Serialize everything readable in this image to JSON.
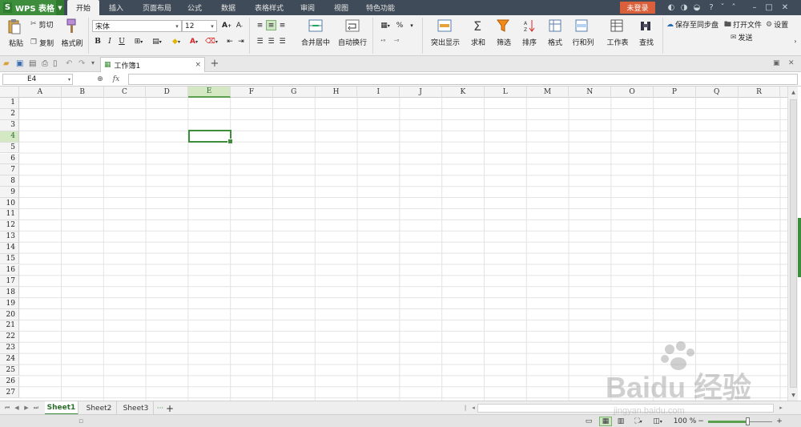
{
  "app": {
    "name": "WPS 表格",
    "logo_letter": "S"
  },
  "menu_tabs": [
    {
      "label": "开始",
      "active": true
    },
    {
      "label": "插入"
    },
    {
      "label": "页面布局"
    },
    {
      "label": "公式"
    },
    {
      "label": "数据"
    },
    {
      "label": "表格样式"
    },
    {
      "label": "审阅"
    },
    {
      "label": "视图"
    },
    {
      "label": "特色功能"
    }
  ],
  "login_label": "未登录",
  "title_controls": [
    "?",
    "ˇ",
    "˄",
    "–",
    "□",
    "✕"
  ],
  "ribbon": {
    "paste": "粘贴",
    "cut": "剪切",
    "copy": "复制",
    "format_painter": "格式刷",
    "font_name": "宋体",
    "font_size": "12",
    "bold": "B",
    "italic": "I",
    "underline": "U",
    "merge_center": "合并居中",
    "wrap_text": "自动换行",
    "percent": "%",
    "conditional_format": "突出显示",
    "sum": "求和",
    "filter": "筛选",
    "sort": "排序",
    "format": "格式",
    "rows_cols": "行和列",
    "worksheet": "工作表",
    "find": "查找",
    "save_sync": "保存至同步盘",
    "open_file": "打开文件",
    "settings": "设置",
    "send": "发送"
  },
  "doc_tab": {
    "title": "工作簿1",
    "close": "×",
    "add": "+"
  },
  "name_box": "E4",
  "formula_fx": "fx",
  "columns": [
    "A",
    "B",
    "C",
    "D",
    "E",
    "F",
    "G",
    "H",
    "I",
    "J",
    "K",
    "L",
    "M",
    "N",
    "O",
    "P",
    "Q",
    "R"
  ],
  "rows": [
    "1",
    "2",
    "3",
    "4",
    "5",
    "6",
    "7",
    "8",
    "9",
    "10",
    "11",
    "12",
    "13",
    "14",
    "15",
    "16",
    "17",
    "18",
    "19",
    "20",
    "21",
    "22",
    "23",
    "24",
    "25",
    "26",
    "27"
  ],
  "selected_column": "E",
  "selected_row": "4",
  "sheets": [
    {
      "label": "Sheet1",
      "active": true
    },
    {
      "label": "Sheet2"
    },
    {
      "label": "Sheet3"
    }
  ],
  "sheet_more": "···",
  "sheet_add": "+",
  "zoom_label": "100 %",
  "zoom_level": 0.6,
  "watermark_text": "Baidu 经验",
  "watermark_sub": "jingyan.baidu.com",
  "accent_color": "#3e8d3a"
}
